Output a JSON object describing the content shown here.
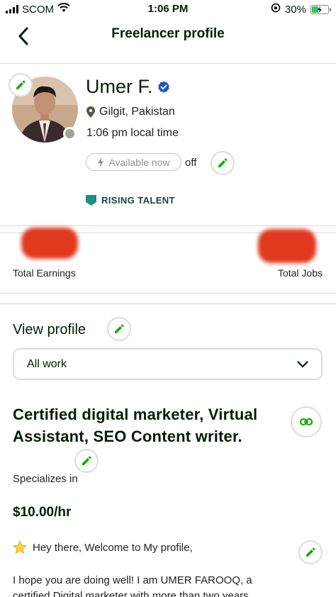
{
  "status_bar": {
    "carrier": "SCOM",
    "time": "1:06 PM",
    "battery": "30%"
  },
  "header": {
    "title": "Freelancer profile"
  },
  "profile": {
    "name": "Umer F.",
    "location": "Gilgit, Pakistan",
    "local_time": "1:06 pm local time",
    "availability_label": "Available now",
    "availability_state": "off",
    "badge": "RISING TALENT"
  },
  "stats": {
    "earnings_label": "Total Earnings",
    "jobs_label": "Total Jobs"
  },
  "view_profile": {
    "title": "View profile",
    "selected_option": "All work"
  },
  "listing": {
    "title": "Certified digital marketer, Virtual Assistant, SEO Content writer.",
    "specializes_label": "Specializes in",
    "rate": "$10.00/hr",
    "greeting": "Hey there, Welcome to My profile,",
    "bio": "I hope you are doing well! I am UMER FAROOQ, a certified Digital marketer with more than two years"
  },
  "colors": {
    "brand_green": "#14a800",
    "verified_blue": "#1f57c3",
    "badge_teal": "#14453d",
    "redaction_red": "#e0391e"
  },
  "icons": {
    "back": "chevron-left-icon",
    "edit": "pencil-icon",
    "verified": "verified-badge-icon",
    "location": "map-pin-icon",
    "bolt": "lightning-icon",
    "badge": "shield-badge-icon",
    "dropdown": "chevron-down-icon",
    "link": "link-icon",
    "star": "star-icon"
  }
}
